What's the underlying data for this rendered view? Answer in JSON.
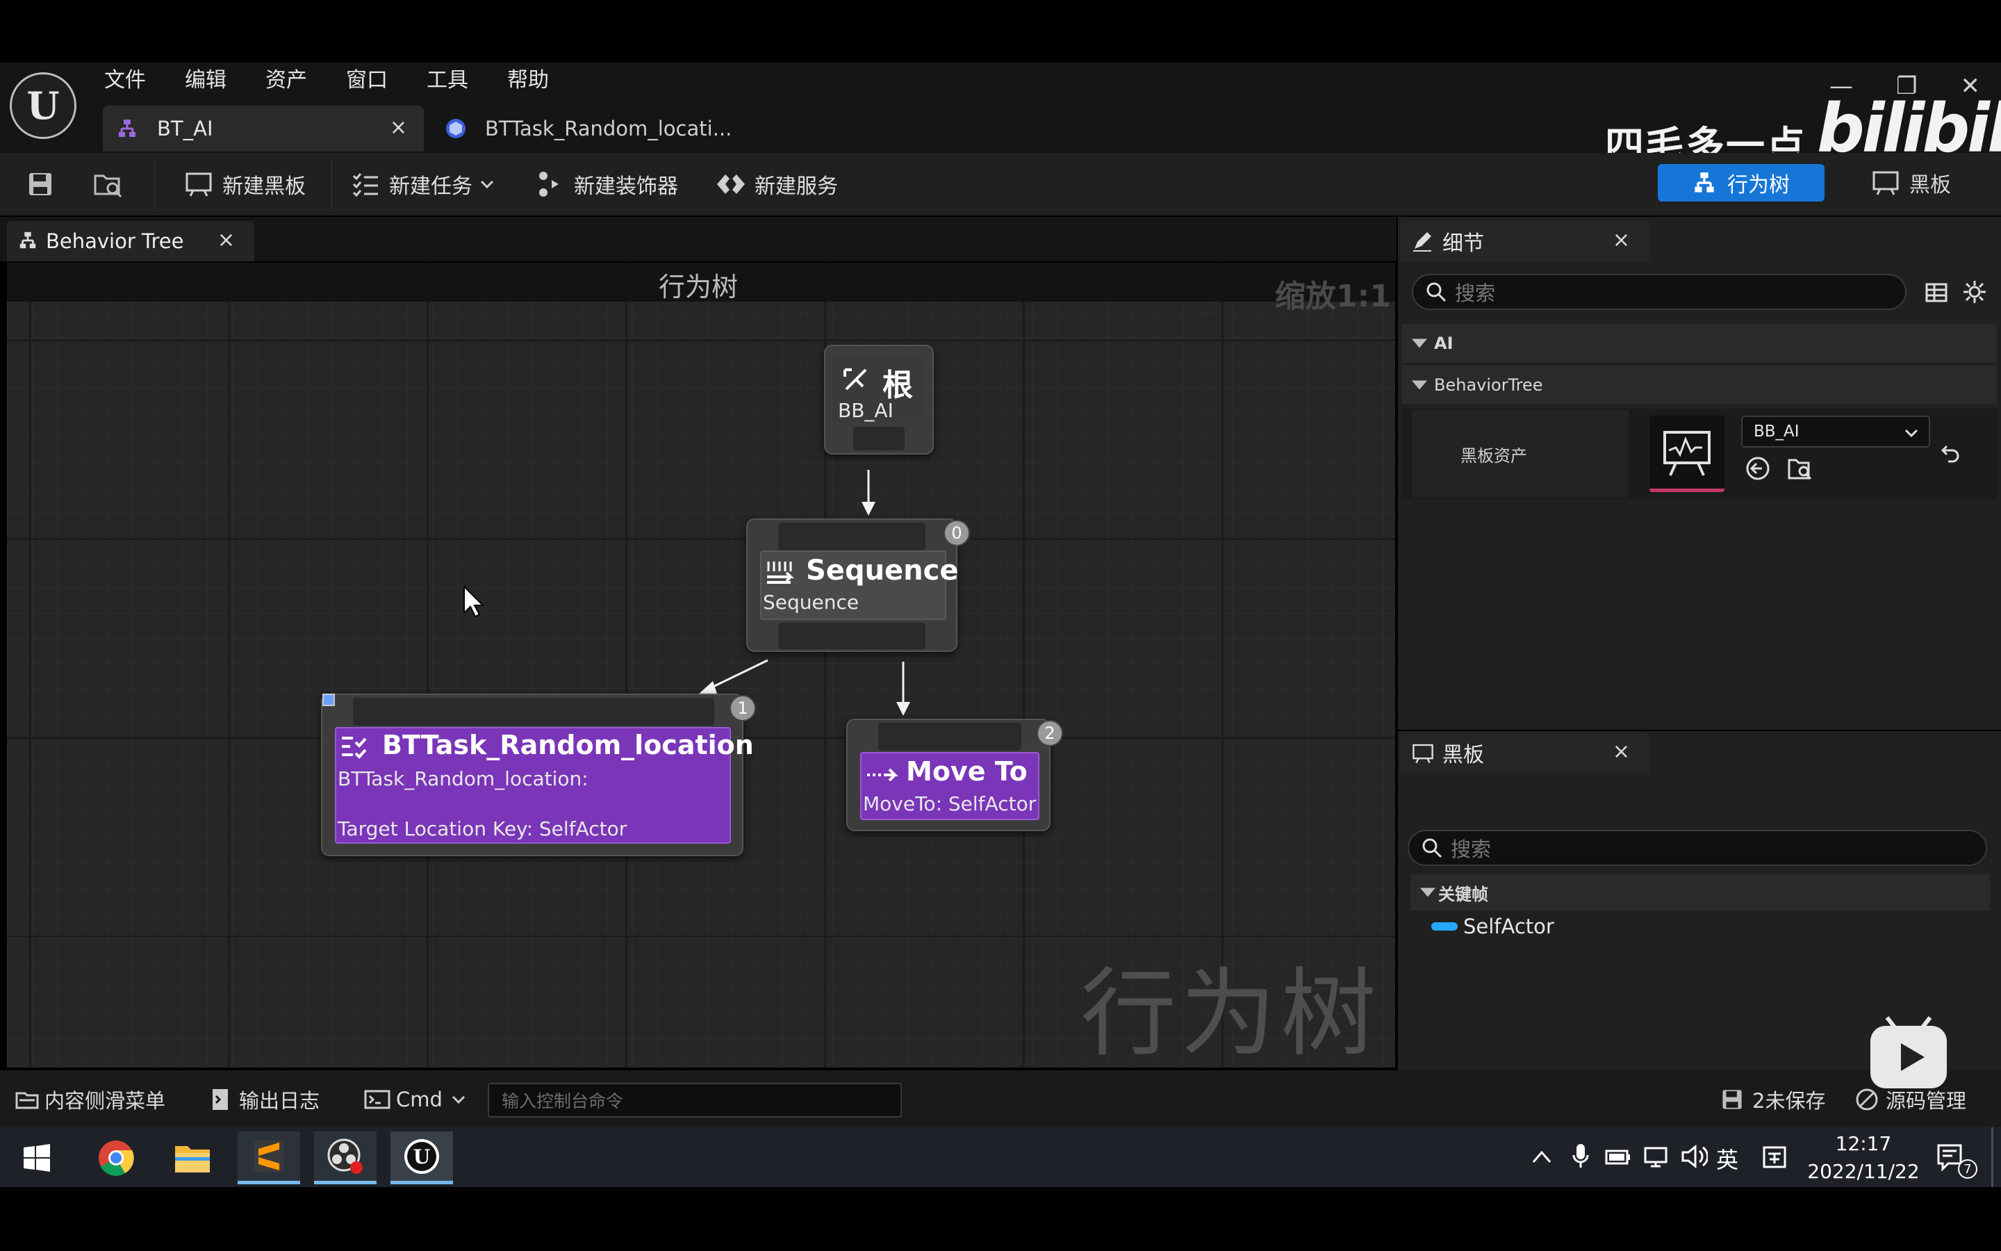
{
  "menu": [
    "文件",
    "编辑",
    "资产",
    "窗口",
    "工具",
    "帮助"
  ],
  "tabs": {
    "active": "BT_AI",
    "second": "BTTask_Random_locati..."
  },
  "close_glyph": "×",
  "toolbar": {
    "new_blackboard": "新建黑板",
    "new_task": "新建任务",
    "new_decorator": "新建装饰器",
    "new_service": "新建服务"
  },
  "modes": {
    "behavior_tree": "行为树",
    "blackboard": "黑板"
  },
  "watermark_logo": {
    "cn": "四毛多一点",
    "en": "bilibili"
  },
  "graph": {
    "tab_label": "Behavior Tree",
    "title": "行为树",
    "zoom": "缩放1:1",
    "watermark": "行为树",
    "nodes": {
      "root": {
        "title": "根",
        "sub": "BB_AI"
      },
      "sequence": {
        "title": "Sequence",
        "sub": "Sequence",
        "index": "0"
      },
      "task": {
        "title": "BTTask_Random_location",
        "sub": "BTTask_Random_location:",
        "detail": "Target Location Key: SelfActor",
        "index": "1"
      },
      "moveto": {
        "title": "Move To",
        "sub": "MoveTo: SelfActor",
        "index": "2"
      }
    }
  },
  "details": {
    "tab_label": "细节",
    "search_placeholder": "搜索",
    "cat_ai": "AI",
    "cat_bt": "BehaviorTree",
    "prop_label": "黑板资产",
    "prop_value": "BB_AI"
  },
  "blackboard": {
    "tab_label": "黑板",
    "search_placeholder": "搜索",
    "category": "关键帧",
    "keys": [
      "SelfActor"
    ]
  },
  "status": {
    "content_drawer": "内容侧滑菜单",
    "output_log": "输出日志",
    "cmd": "Cmd",
    "console_placeholder": "输入控制台命令",
    "unsaved": "2未保存",
    "source_control": "源码管理"
  },
  "taskbar": {
    "ime": "英",
    "time": "12:17",
    "date": "2022/11/22",
    "notifications": "7"
  }
}
